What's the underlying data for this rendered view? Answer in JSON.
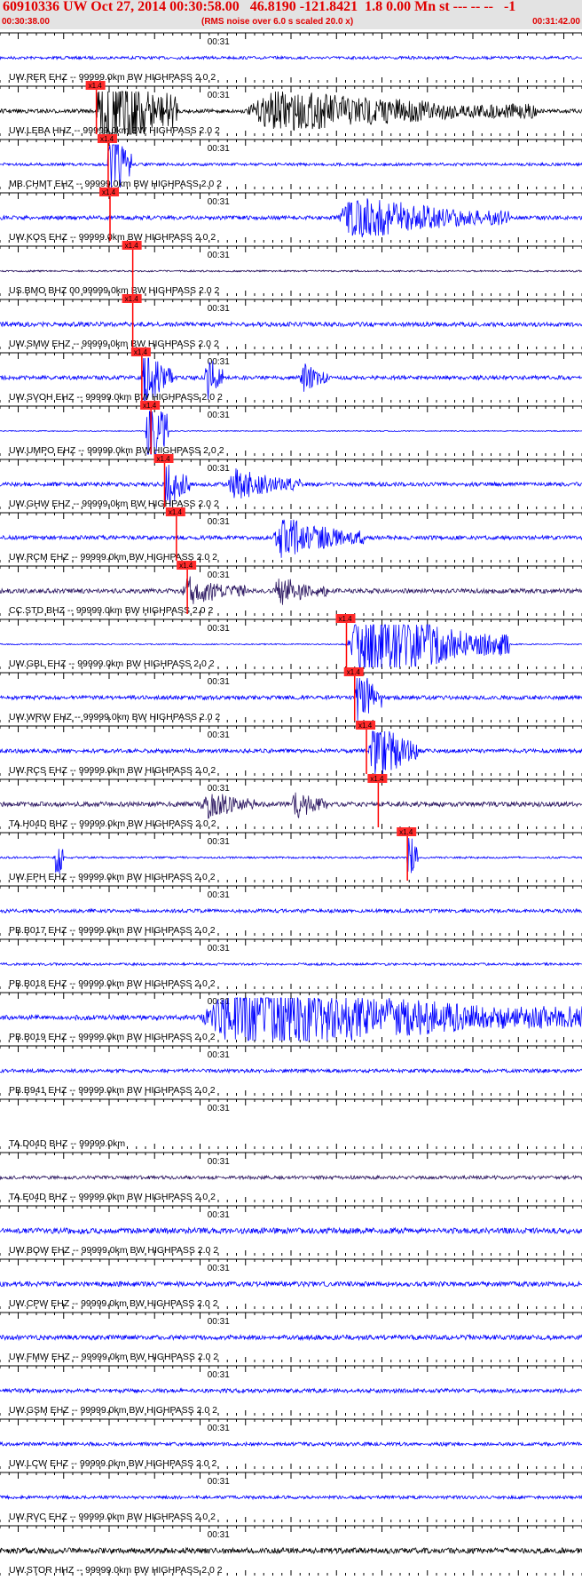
{
  "header": {
    "title": "60910336 UW Oct 27, 2014 00:30:58.00   46.8190 -121.8421  1.8 0.00 Mn st --- -- --   -1",
    "start_time": "00:30:38.00",
    "end_time": "00:31:42.00",
    "note": "(RMS noise over 6.0 s scaled 20.0 x)"
  },
  "chart_data": {
    "type": "line",
    "title": "",
    "x_axis": {
      "start": "00:30:38.00",
      "end": "00:31:42.00",
      "tick_label": "00:31",
      "major_tick_seconds": 5,
      "minor_tick_seconds": 1
    },
    "pick_label": "x1.4",
    "colors": {
      "header_text": "#e00000",
      "header_bg": "#e3e3e3",
      "pick": "#ff0000",
      "pick_box": "#ff2a2a",
      "trace_blue": "#0000ff",
      "trace_black": "#000000",
      "trace_dark": "#2a1560"
    },
    "traces": [
      {
        "label": "UW.RER EHZ -- 99999.0km BW  HIGHPASS  2.0  2",
        "color": "blue",
        "amp": 0.18,
        "bursts": []
      },
      {
        "label": "UW.LEBA HHZ -- 99999.0km BW  HIGHPASS  2.0  2",
        "color": "black",
        "amp": 0.25,
        "pick": 10.5,
        "bursts": [
          [
            10.5,
            19.5,
            9
          ],
          [
            27,
            59,
            3
          ]
        ]
      },
      {
        "label": "MB.CHMT EHZ -- 99999.0km BW  HIGHPASS  2.0  2",
        "color": "blue",
        "amp": 0.18,
        "pick": 11.8,
        "bursts": [
          [
            11.8,
            14.5,
            7
          ]
        ]
      },
      {
        "label": "UW.KOS EHZ -- 99999.0km BW  HIGHPASS  2.0  2",
        "color": "blue",
        "amp": 0.25,
        "pick": 12.0,
        "bursts": [
          [
            37,
            56,
            3
          ]
        ]
      },
      {
        "label": "US.BMO BHZ 00 99999.0km BW  HIGHPASS  2.0  2",
        "color": "dark",
        "amp": 0.1,
        "pick": 14.5,
        "bursts": []
      },
      {
        "label": "UW.SMW EHZ -- 99999.0km BW  HIGHPASS  2.0  2",
        "color": "blue",
        "amp": 0.28,
        "pick": 14.5,
        "bursts": []
      },
      {
        "label": "UW.SVOH EHZ -- 99999.0km BW  HIGHPASS  2.0  2",
        "color": "blue",
        "amp": 0.25,
        "pick": 15.5,
        "bursts": [
          [
            15.5,
            19,
            5
          ],
          [
            22.5,
            24.5,
            4
          ],
          [
            33,
            36,
            2.5
          ]
        ]
      },
      {
        "label": "UW.UMPO EHZ -- 99999.0km BW  HIGHPASS  2.0  2",
        "color": "blue",
        "amp": 0.06,
        "pick": 16.5,
        "bursts": [
          [
            16,
            18.5,
            10
          ]
        ]
      },
      {
        "label": "UW.GHW EHZ -- 99999.0km BW  HIGHPASS  2.0  2",
        "color": "blue",
        "amp": 0.25,
        "pick": 18.0,
        "bursts": [
          [
            18,
            21,
            4
          ],
          [
            25,
            33,
            2.2
          ]
        ]
      },
      {
        "label": "UW.RCM EHZ -- 99999.0km BW  HIGHPASS  2.0  2",
        "color": "blue",
        "amp": 0.25,
        "pick": 19.3,
        "bursts": [
          [
            30,
            40,
            3
          ]
        ]
      },
      {
        "label": "CC.STD BHZ -- 99999.0km BW  HIGHPASS  2.0  2",
        "color": "dark",
        "amp": 0.28,
        "pick": 20.5,
        "bursts": [
          [
            20,
            27,
            2
          ],
          [
            30,
            36,
            2
          ]
        ]
      },
      {
        "label": "UW.GBL EHZ -- 99999.0km BW  HIGHPASS  2.0  2",
        "color": "blue",
        "amp": 0.08,
        "pick": 38.0,
        "bursts": [
          [
            38,
            56,
            6
          ]
        ]
      },
      {
        "label": "UW.WRW EHZ -- 99999.0km BW  HIGHPASS  2.0  2",
        "color": "blue",
        "amp": 0.25,
        "pick": 38.9,
        "bursts": [
          [
            39,
            42,
            5
          ]
        ]
      },
      {
        "label": "UW.RCS EHZ -- 99999.0km BW  HIGHPASS  2.0  2",
        "color": "blue",
        "amp": 0.25,
        "pick": 40.2,
        "bursts": [
          [
            40.5,
            46,
            5
          ]
        ]
      },
      {
        "label": "TA.H04D BHZ -- 99999.0km BW  HIGHPASS  2.0  2",
        "color": "dark",
        "amp": 0.3,
        "pick": 41.5,
        "bursts": [
          [
            22,
            28,
            2
          ],
          [
            32,
            36,
            2
          ]
        ]
      },
      {
        "label": "UW.EPH EHZ -- 99999.0km BW  HIGHPASS  2.0  2",
        "color": "blue",
        "amp": 0.12,
        "pick": 44.7,
        "bursts": [
          [
            44.7,
            46,
            6
          ],
          [
            6,
            7,
            6
          ]
        ]
      },
      {
        "label": "PB.B017 EHZ -- 99999.0km BW  HIGHPASS  2.0  2",
        "color": "blue",
        "amp": 0.22,
        "bursts": []
      },
      {
        "label": "PB.B018 EHZ -- 99999.0km BW  HIGHPASS  2.0  2",
        "color": "blue",
        "amp": 0.15,
        "bursts": []
      },
      {
        "label": "PB.B019 EHZ -- 99999.0km BW  HIGHPASS  2.0  2",
        "color": "blue",
        "amp": 0.3,
        "bursts": [
          [
            22,
            64,
            5
          ]
        ]
      },
      {
        "label": "PB.B941 EHZ -- 99999.0km BW  HIGHPASS  2.0  2",
        "color": "blue",
        "amp": 0.22,
        "bursts": []
      },
      {
        "label": "TA.D04D BHZ -- 99999.0km",
        "color": "none",
        "amp": 0,
        "bursts": []
      },
      {
        "label": "TA.E04D BHZ -- 99999.0km BW  HIGHPASS  2.0  2",
        "color": "dark",
        "amp": 0.22,
        "bursts": []
      },
      {
        "label": "UW.BOW EHZ -- 99999.0km BW  HIGHPASS  2.0  2",
        "color": "blue",
        "amp": 0.35,
        "bursts": []
      },
      {
        "label": "UW.CPW EHZ -- 99999.0km BW  HIGHPASS  2.0  2",
        "color": "blue",
        "amp": 0.3,
        "bursts": []
      },
      {
        "label": "UW.FMW EHZ -- 99999.0km BW  HIGHPASS  2.0  2",
        "color": "blue",
        "amp": 0.3,
        "bursts": []
      },
      {
        "label": "UW.GSM EHZ -- 99999.0km BW  HIGHPASS  2.0  2",
        "color": "blue",
        "amp": 0.25,
        "bursts": []
      },
      {
        "label": "UW.LCW EHZ -- 99999.0km BW  HIGHPASS  2.0  2",
        "color": "blue",
        "amp": 0.22,
        "bursts": []
      },
      {
        "label": "UW.RVC EHZ -- 99999.0km BW  HIGHPASS  2.0  2",
        "color": "blue",
        "amp": 0.2,
        "bursts": []
      },
      {
        "label": "UW.STOR HHZ -- 99999.0km BW  HIGHPASS  2.0  2",
        "color": "black",
        "amp": 0.35,
        "bursts": []
      }
    ]
  }
}
